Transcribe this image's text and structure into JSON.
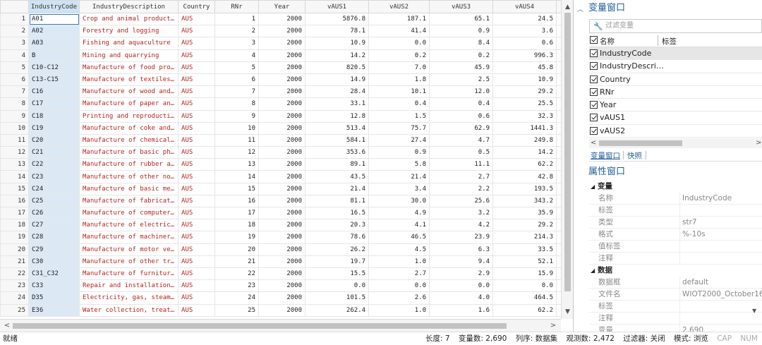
{
  "grid": {
    "columns": [
      "IndustryCode",
      "IndustryDescription",
      "Country",
      "RNr",
      "Year",
      "vAUS1",
      "vAUS2",
      "vAUS3",
      "vAUS4"
    ],
    "rows": [
      [
        "1",
        "A01",
        "Crop and animal producti…",
        "AUS",
        "1",
        "2000",
        "5876.8",
        "187.1",
        "65.1",
        "24.5"
      ],
      [
        "2",
        "A02",
        "Forestry and logging",
        "AUS",
        "2",
        "2000",
        "78.1",
        "41.4",
        "0.9",
        "3.6"
      ],
      [
        "3",
        "A03",
        "Fishing and aquaculture",
        "AUS",
        "3",
        "2000",
        "10.9",
        "0.0",
        "8.4",
        "0.6"
      ],
      [
        "4",
        "B",
        "Mining and quarrying",
        "AUS",
        "4",
        "2000",
        "14.2",
        "0.2",
        "0.2",
        "996.3"
      ],
      [
        "5",
        "C10-C12",
        "Manufacture of food prod…",
        "AUS",
        "5",
        "2000",
        "820.5",
        "7.0",
        "45.9",
        "45.8"
      ],
      [
        "6",
        "C13-C15",
        "Manufacture of textiles,…",
        "AUS",
        "6",
        "2000",
        "14.9",
        "1.8",
        "2.5",
        "10.9"
      ],
      [
        "7",
        "C16",
        "Manufacture of wood and …",
        "AUS",
        "7",
        "2000",
        "28.4",
        "10.1",
        "12.0",
        "29.2"
      ],
      [
        "8",
        "C17",
        "Manufacture of paper and…",
        "AUS",
        "8",
        "2000",
        "33.1",
        "0.4",
        "0.4",
        "25.5"
      ],
      [
        "9",
        "C18",
        "Printing and reproductio…",
        "AUS",
        "9",
        "2000",
        "12.8",
        "1.5",
        "0.6",
        "32.3"
      ],
      [
        "10",
        "C19",
        "Manufacture of coke and …",
        "AUS",
        "10",
        "2000",
        "513.4",
        "75.7",
        "62.9",
        "1441.3"
      ],
      [
        "11",
        "C20",
        "Manufacture of chemicals…",
        "AUS",
        "11",
        "2000",
        "584.1",
        "27.4",
        "4.7",
        "249.8"
      ],
      [
        "12",
        "C21",
        "Manufacture of basic pha…",
        "AUS",
        "12",
        "2000",
        "353.6",
        "0.9",
        "0.5",
        "14.2"
      ],
      [
        "13",
        "C22",
        "Manufacture of rubber an…",
        "AUS",
        "13",
        "2000",
        "89.1",
        "5.8",
        "11.1",
        "62.2"
      ],
      [
        "14",
        "C23",
        "Manufacture of other non…",
        "AUS",
        "14",
        "2000",
        "43.5",
        "21.4",
        "2.7",
        "42.8"
      ],
      [
        "15",
        "C24",
        "Manufacture of basic met…",
        "AUS",
        "15",
        "2000",
        "21.4",
        "3.4",
        "2.2",
        "193.5"
      ],
      [
        "16",
        "C25",
        "Manufacture of fabricate…",
        "AUS",
        "16",
        "2000",
        "81.1",
        "30.0",
        "25.6",
        "343.2"
      ],
      [
        "17",
        "C26",
        "Manufacture of computer,…",
        "AUS",
        "17",
        "2000",
        "16.5",
        "4.9",
        "3.2",
        "35.9"
      ],
      [
        "18",
        "C27",
        "Manufacture of electrica…",
        "AUS",
        "18",
        "2000",
        "20.3",
        "4.1",
        "4.2",
        "29.2"
      ],
      [
        "19",
        "C28",
        "Manufacture of machinery…",
        "AUS",
        "19",
        "2000",
        "78.6",
        "46.5",
        "23.9",
        "214.3"
      ],
      [
        "20",
        "C29",
        "Manufacture of motor veh…",
        "AUS",
        "20",
        "2000",
        "26.2",
        "4.5",
        "6.3",
        "33.5"
      ],
      [
        "21",
        "C30",
        "Manufacture of other tra…",
        "AUS",
        "21",
        "2000",
        "19.7",
        "1.0",
        "9.4",
        "52.1"
      ],
      [
        "22",
        "C31_C32",
        "Manufacture of furniture…",
        "AUS",
        "22",
        "2000",
        "15.5",
        "2.7",
        "2.9",
        "15.9"
      ],
      [
        "23",
        "C33",
        "Repair and installation …",
        "AUS",
        "23",
        "2000",
        "0.0",
        "0.0",
        "0.0",
        "0.0"
      ],
      [
        "24",
        "D35",
        "Electricity, gas, steam …",
        "AUS",
        "24",
        "2000",
        "101.5",
        "2.6",
        "4.0",
        "464.5"
      ],
      [
        "25",
        "E36",
        "Water collection, treatm…",
        "AUS",
        "25",
        "2000",
        "262.4",
        "1.0",
        "1.6",
        "62.2"
      ]
    ]
  },
  "variables_window": {
    "title": "变量窗口",
    "filter_placeholder": "过滤变量",
    "header_name": "名称",
    "header_label": "标签",
    "items": [
      "IndustryCode",
      "IndustryDescri…",
      "Country",
      "RNr",
      "Year",
      "vAUS1",
      "vAUS2"
    ],
    "tabs": [
      "变量窗口",
      "快照"
    ]
  },
  "properties_window": {
    "title": "属性窗口",
    "variable_section": "变量",
    "variable_rows": [
      {
        "k": "名称",
        "v": "IndustryCode"
      },
      {
        "k": "标签",
        "v": ""
      },
      {
        "k": "类型",
        "v": "str7"
      },
      {
        "k": "格式",
        "v": "%-10s"
      },
      {
        "k": "值标签",
        "v": ""
      },
      {
        "k": "注释",
        "v": ""
      }
    ],
    "data_section": "数据",
    "data_rows": [
      {
        "k": "数据框",
        "v": "default"
      },
      {
        "k": "文件名",
        "v": "WIOT2000_October16"
      },
      {
        "k": "标签",
        "v": ""
      },
      {
        "k": "注释",
        "v": ""
      },
      {
        "k": "变量",
        "v": "2,690"
      }
    ]
  },
  "status_bar": {
    "ready": "就绪",
    "length": "长度: 7",
    "variables": "变量数: 2,690",
    "order": "列序: 数据集",
    "observations": "观测数: 2,472",
    "filter": "过滤器: 关闭",
    "mode": "模式: 浏览",
    "cap": "CAP",
    "num": "NUM"
  }
}
